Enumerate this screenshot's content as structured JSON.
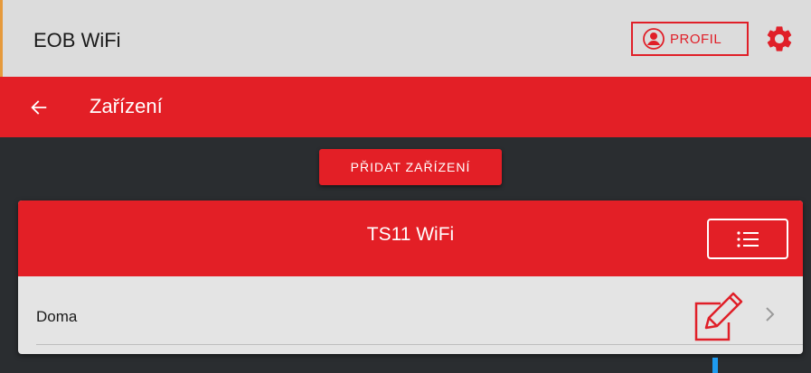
{
  "app": {
    "title": "EOB WiFi"
  },
  "topbar": {
    "profile_label": "PROFIL"
  },
  "header": {
    "title": "Zařízení"
  },
  "actions": {
    "add_device_label": "PŘIDAT ZAŘÍZENÍ"
  },
  "device": {
    "name": "TS11 WiFi",
    "location": "Doma"
  },
  "colors": {
    "accent": "#e31f26",
    "background": "#2a2d30",
    "topbar": "#dcdcdc",
    "card": "#e4e4e4"
  }
}
